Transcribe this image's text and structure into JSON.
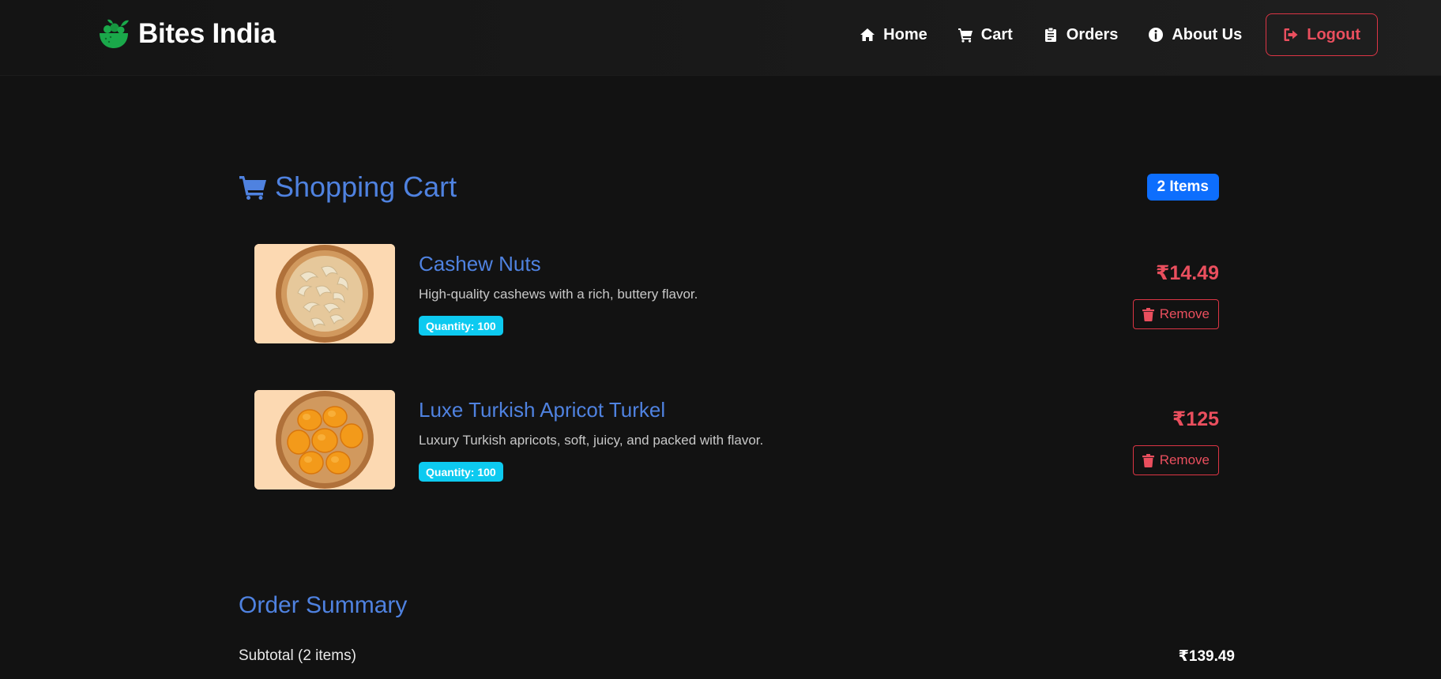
{
  "brand": {
    "name": "Bites India",
    "logo_icon": "fruit-basket-icon",
    "logo_color": "#1aa84a"
  },
  "nav": {
    "items": [
      {
        "label": "Home",
        "icon": "home-icon"
      },
      {
        "label": "Cart",
        "icon": "cart-icon"
      },
      {
        "label": "Orders",
        "icon": "clipboard-icon"
      },
      {
        "label": "About Us",
        "icon": "info-icon"
      }
    ],
    "logout": {
      "label": "Logout",
      "icon": "sign-out-icon",
      "color": "#dc3545"
    }
  },
  "cart": {
    "title": "Shopping Cart",
    "title_icon": "cart-icon",
    "title_color": "#4f82e0",
    "count_badge": "2 Items",
    "items": [
      {
        "name": "Cashew Nuts",
        "description": "High-quality cashews with a rich, buttery flavor.",
        "quantity": "Quantity: 100",
        "price": "₹14.49",
        "remove_label": "Remove",
        "image": "cashew-nuts-bowl"
      },
      {
        "name": "Luxe Turkish Apricot Turkel",
        "description": "Luxury Turkish apricots, soft, juicy, and packed with flavor.",
        "quantity": "Quantity: 100",
        "price": "₹125",
        "remove_label": "Remove",
        "image": "dried-apricots-bowl"
      }
    ]
  },
  "summary": {
    "title": "Order Summary",
    "subtotal_label": "Subtotal (2 items)",
    "subtotal_value": "₹139.49"
  },
  "colors": {
    "background": "#121212",
    "accent_blue": "#4f82e0",
    "badge_blue": "#0d6efd",
    "badge_cyan": "#0dcaf0",
    "danger": "#dc3545"
  }
}
